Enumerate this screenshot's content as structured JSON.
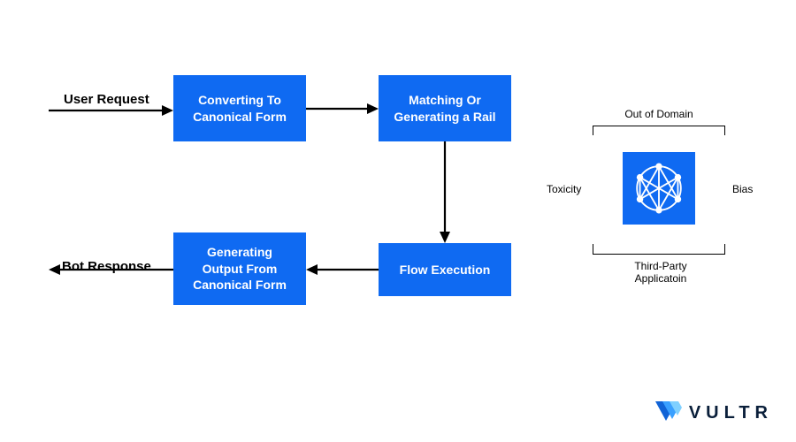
{
  "labels": {
    "user_request": "User Request",
    "bot_response": "Bot Response"
  },
  "boxes": {
    "convert": "Converting To\nCanonical Form",
    "match": "Matching Or\nGenerating a Rail",
    "flow": "Flow Execution",
    "generate": "Generating\nOutput From\nCanonical Form"
  },
  "guardrails": {
    "top": "Out of Domain",
    "left": "Toxicity",
    "right": "Bias",
    "bottom": "Third-Party\nApplicatoin"
  },
  "brand": {
    "name": "VULTR"
  },
  "colors": {
    "accent": "#0f6af2",
    "text": "#000000"
  },
  "icons": {
    "neural_net": "neural-net-icon",
    "logo_mark": "vultr-mark-icon"
  }
}
